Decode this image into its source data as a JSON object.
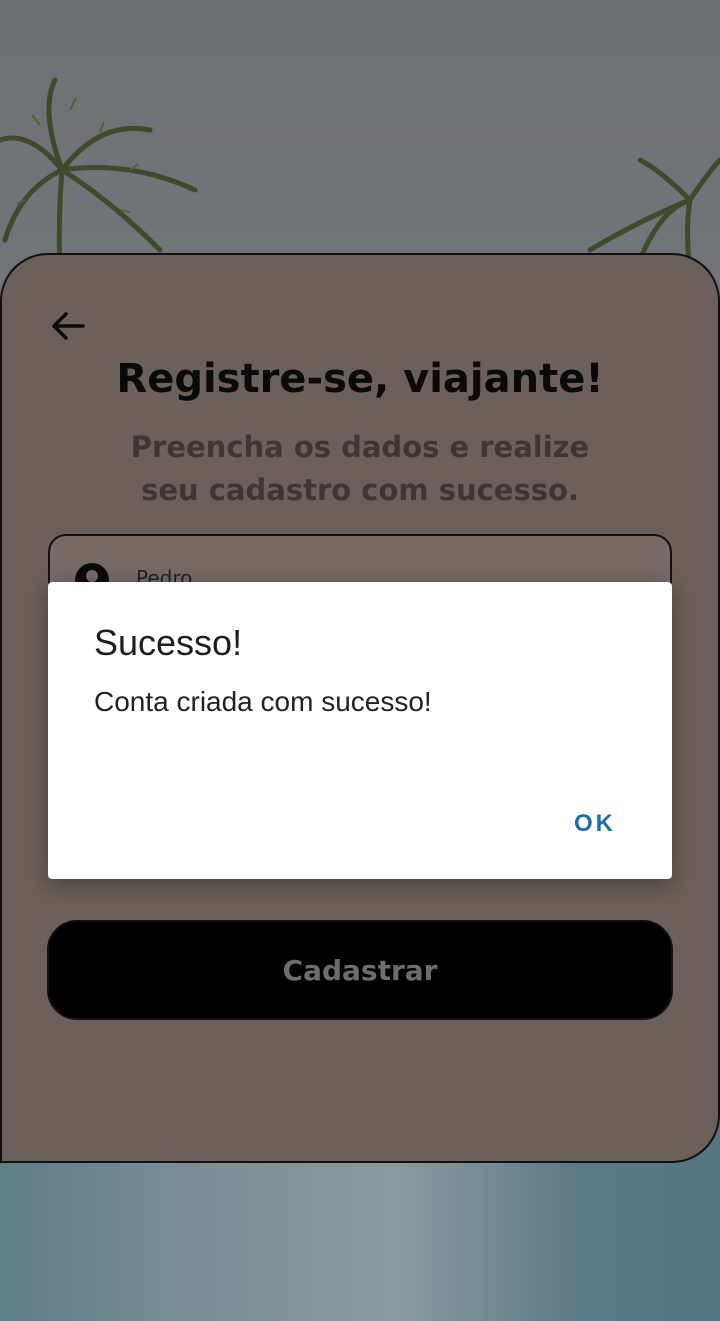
{
  "register": {
    "back_icon": "arrow-left-icon",
    "title": "Registre-se, viajante!",
    "subtitle": "Preencha os dados e realize seu cadastro com sucesso.",
    "fields": [
      {
        "icon": "user-icon",
        "value": "Pedro"
      }
    ],
    "submit_label": "Cadastrar"
  },
  "dialog": {
    "title": "Sucesso!",
    "message": "Conta criada com sucesso!",
    "ok_label": "OK"
  },
  "colors": {
    "card_bg": "#6c605c",
    "dialog_accent": "#1d6fa5",
    "button_bg": "#000000"
  }
}
